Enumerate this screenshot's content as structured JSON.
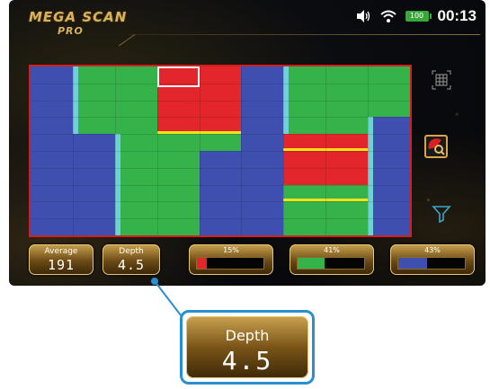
{
  "app": {
    "logo_line1": "MEGA SCAN",
    "logo_line2": "PRO"
  },
  "status_bar": {
    "sound_icon": "speaker-icon",
    "wifi_icon": "wifi-icon",
    "battery_label": "100",
    "time": "00:13"
  },
  "colors": {
    "blue": "#3f4fb0",
    "green": "#36b24a",
    "red": "#e3262b",
    "yellow": "#f2e21a",
    "cyan": "#6fd0d8",
    "border_red": "#d61d1d",
    "gold": "#c9a24e"
  },
  "scan_map": {
    "rows": 10,
    "cols": 9,
    "cells": [
      [
        "blue",
        "green",
        "green",
        "red",
        "red",
        "blue",
        "green",
        "green",
        "green"
      ],
      [
        "blue",
        "green",
        "green",
        "red",
        "red",
        "blue",
        "green",
        "green",
        "green"
      ],
      [
        "blue",
        "green",
        "green",
        "red",
        "red",
        "blue",
        "green",
        "green",
        "green"
      ],
      [
        "blue",
        "green",
        "green",
        "red",
        "red",
        "blue",
        "green",
        "green",
        "blue"
      ],
      [
        "blue",
        "blue",
        "green",
        "green",
        "green",
        "blue",
        "red",
        "red",
        "blue"
      ],
      [
        "blue",
        "blue",
        "green",
        "green",
        "blue",
        "blue",
        "red",
        "red",
        "blue"
      ],
      [
        "blue",
        "blue",
        "green",
        "green",
        "blue",
        "blue",
        "red",
        "red",
        "blue"
      ],
      [
        "blue",
        "blue",
        "green",
        "green",
        "blue",
        "blue",
        "green",
        "green",
        "blue"
      ],
      [
        "blue",
        "blue",
        "green",
        "green",
        "blue",
        "blue",
        "green",
        "green",
        "blue"
      ],
      [
        "blue",
        "blue",
        "green",
        "green",
        "blue",
        "blue",
        "green",
        "green",
        "blue"
      ]
    ]
  },
  "side_icons": {
    "grid": "grid-view-icon",
    "target": "target-scan-icon",
    "filter": "filter-icon"
  },
  "metrics": {
    "average_label": "Average",
    "average_value": "191",
    "depth_label": "Depth",
    "depth_value": "4.5"
  },
  "percent_bars": [
    {
      "label": "15%",
      "value": 0.15,
      "color": "#e3262b"
    },
    {
      "label": "41%",
      "value": 0.41,
      "color": "#36b24a"
    },
    {
      "label": "43%",
      "value": 0.43,
      "color": "#3f4fb0"
    }
  ],
  "callout": {
    "label": "Depth",
    "value": "4.5"
  }
}
